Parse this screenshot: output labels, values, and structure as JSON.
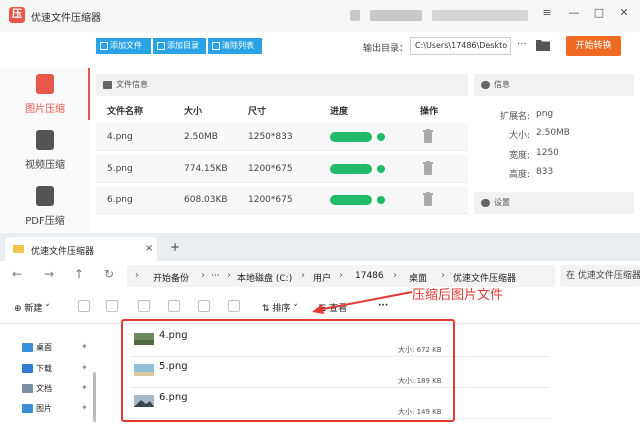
{
  "app": {
    "title": "优速文件压缩器",
    "toolbar": {
      "add_file": "添加文件",
      "add_dir": "添加目录",
      "clear_list": "清除列表",
      "output_label": "输出目录：",
      "output_path": "C:\\Users\\17486\\Deskto",
      "more": "···",
      "start": "开始转换"
    },
    "sidebar": {
      "items": [
        {
          "label": "图片压缩",
          "icon": "image-file-icon",
          "color": "#e8584a"
        },
        {
          "label": "视频压缩",
          "icon": "video-file-icon",
          "color": "#555555"
        },
        {
          "label": "PDF压缩",
          "icon": "pdf-file-icon",
          "color": "#555555"
        }
      ]
    },
    "file_info": {
      "heading": "文件信息",
      "columns": [
        "文件名称",
        "大小",
        "尺寸",
        "进度",
        "操作"
      ],
      "rows": [
        {
          "name": "4.png",
          "size": "2.50MB",
          "dims": "1250*833",
          "progress": 1.0
        },
        {
          "name": "5.png",
          "size": "774.15KB",
          "dims": "1200*675",
          "progress": 1.0
        },
        {
          "name": "6.png",
          "size": "608.03KB",
          "dims": "1200*675",
          "progress": 1.0
        }
      ]
    },
    "info_panel": {
      "heading": "信息",
      "fields": [
        {
          "key": "扩展名:",
          "value": "png"
        },
        {
          "key": "大小:",
          "value": "2.50MB"
        },
        {
          "key": "宽度:",
          "value": "1250"
        },
        {
          "key": "高度:",
          "value": "833"
        }
      ],
      "settings_heading": "设置"
    },
    "colors": {
      "accent": "#e8584a",
      "primary_button": "#29a3e6",
      "start_button": "#ef6b23",
      "progress": "#1fbb6b"
    }
  },
  "explorer": {
    "tab_title": "优速文件压缩器",
    "tab_close": "×",
    "new_tab": "+",
    "nav": {
      "back": "←",
      "forward": "→",
      "up": "↑",
      "refresh": "↻"
    },
    "breadcrumb": [
      "开始备份",
      "本地磁盘 (C:)",
      "用户",
      "17486",
      "桌面",
      "优速文件压缩器"
    ],
    "more_crumbs": "···",
    "search_placeholder": "在 优速文件压缩器",
    "commands": {
      "new": "新建",
      "sort": "排序",
      "view": "查看",
      "more": "···"
    },
    "nav_items": [
      {
        "label": "桌面",
        "icon": "desktop-icon",
        "color": "#3a8fd6"
      },
      {
        "label": "下载",
        "icon": "download-icon",
        "color": "#2f7bd1"
      },
      {
        "label": "文档",
        "icon": "document-icon",
        "color": "#7a8fa6"
      },
      {
        "label": "图片",
        "icon": "pictures-icon",
        "color": "#3a8fd6"
      }
    ],
    "files": [
      {
        "name": "4.png",
        "size": "大小: 672 KB",
        "thumb": "#6c8b5a"
      },
      {
        "name": "5.png",
        "size": "大小: 189 KB",
        "thumb": "#8fc0d8"
      },
      {
        "name": "6.png",
        "size": "大小: 149 KB",
        "thumb": "#5d6a7a"
      }
    ],
    "annotation": "压缩后图片文件",
    "annotation_color": "#e53935"
  }
}
